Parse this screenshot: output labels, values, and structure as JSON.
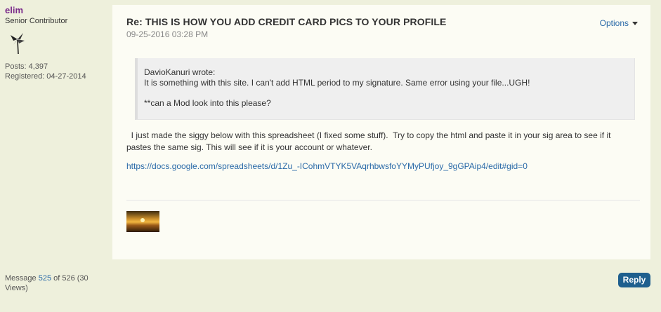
{
  "author": {
    "username": "elim",
    "rank": "Senior Contributor",
    "posts_label": "Posts: 4,397",
    "registered_label": "Registered: 04-27-2014"
  },
  "post": {
    "subject": "Re: THIS IS HOW YOU ADD CREDIT CARD PICS TO YOUR PROFILE",
    "date": "09-25-2016 03:28 PM",
    "options_label": "Options",
    "quote": {
      "author": "DavioKanuri wrote:",
      "line1": "It is something with this site. I can't add HTML period to my signature. Same error using your file...UGH!",
      "line2": "**can a Mod look into this please?"
    },
    "body": "  I just made the siggy below with this spreadsheet (I fixed some stuff).  Try to copy the html and paste it in your sig area to see if it pastes the same sig. This will see if it is your account or whatever.",
    "link": "https://docs.google.com/spreadsheets/d/1Zu_-ICohmVTYK5VAqrhbwsfoYYMyPUfjoy_9gGPAip4/edit#gid=0"
  },
  "meta": {
    "prefix": "Message ",
    "message_number": "525",
    "suffix": " of 526 (30 Views)"
  },
  "reply_label": "Reply"
}
